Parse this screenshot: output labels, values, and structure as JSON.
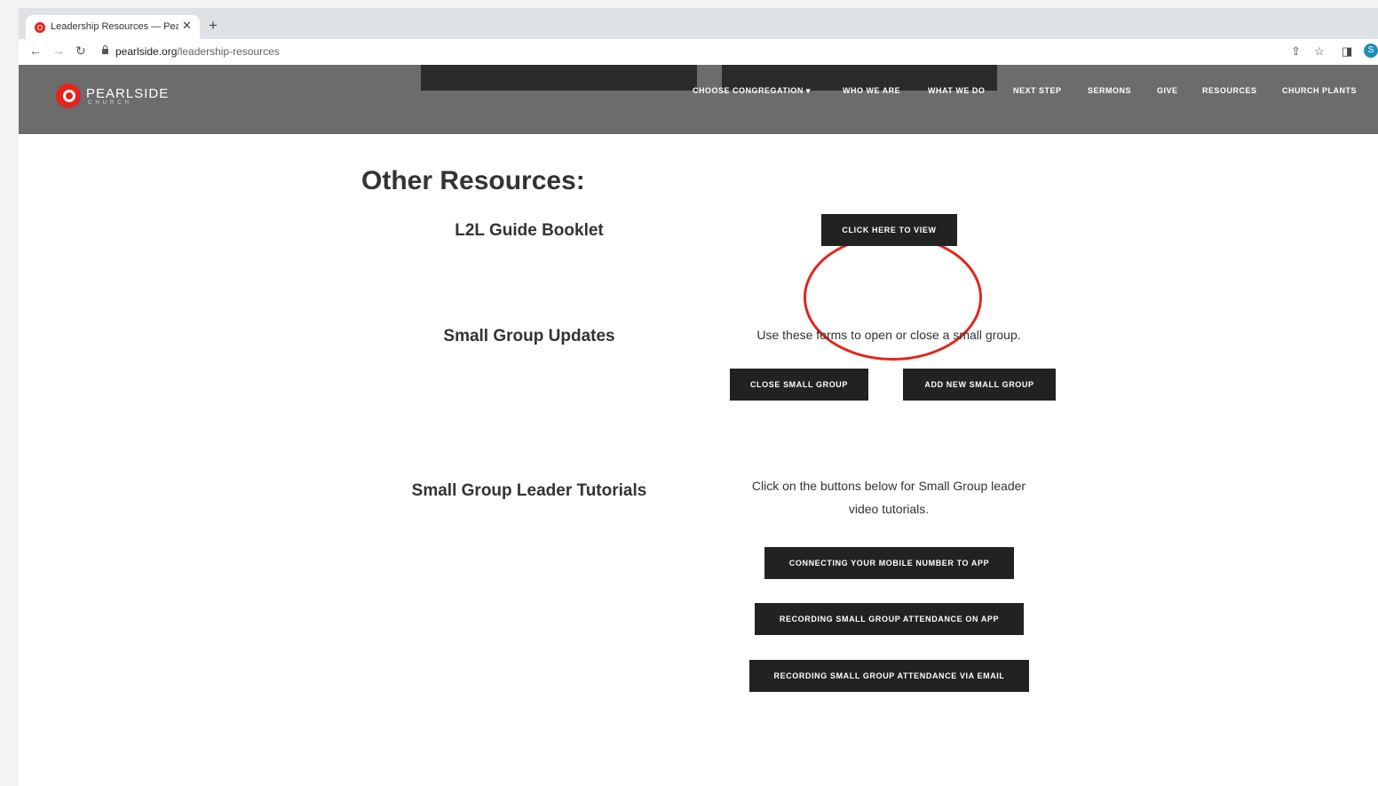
{
  "browser": {
    "tab_title": "Leadership Resources — Pearlside Church",
    "tab_close": "✕",
    "new_tab": "+",
    "url_domain": "pearlside.org",
    "url_path": "/leadership-resources",
    "profile_initial": "S"
  },
  "site": {
    "logo_name": "PEARLSIDE",
    "logo_sub": "CHURCH",
    "nav": [
      "CHOOSE CONGREGATION ▾",
      "WHO WE ARE",
      "WHAT WE DO",
      "NEXT STEP",
      "SERMONS",
      "GIVE",
      "RESOURCES",
      "CHURCH PLANTS"
    ]
  },
  "content": {
    "heading": "Other Resources:",
    "l2l": {
      "label": "L2L Guide Booklet",
      "button": "CLICK HERE TO VIEW"
    },
    "updates": {
      "label": "Small Group Updates",
      "desc": "Use these forms to open or close a small group.",
      "close_button": "CLOSE SMALL GROUP",
      "add_button": "ADD NEW SMALL GROUP"
    },
    "tutorials": {
      "label": "Small Group Leader Tutorials",
      "desc_line1": "Click on the buttons below for Small Group leader",
      "desc_line2": "video tutorials.",
      "buttons": [
        "CONNECTING YOUR MOBILE NUMBER TO APP",
        "RECORDING SMALL GROUP ATTENDANCE ON APP",
        "RECORDING SMALL GROUP ATTENDANCE VIA EMAIL"
      ]
    }
  },
  "colors": {
    "brand_red": "#e2261d",
    "header_gray": "#6c6c6c",
    "button_dark": "#222222"
  }
}
